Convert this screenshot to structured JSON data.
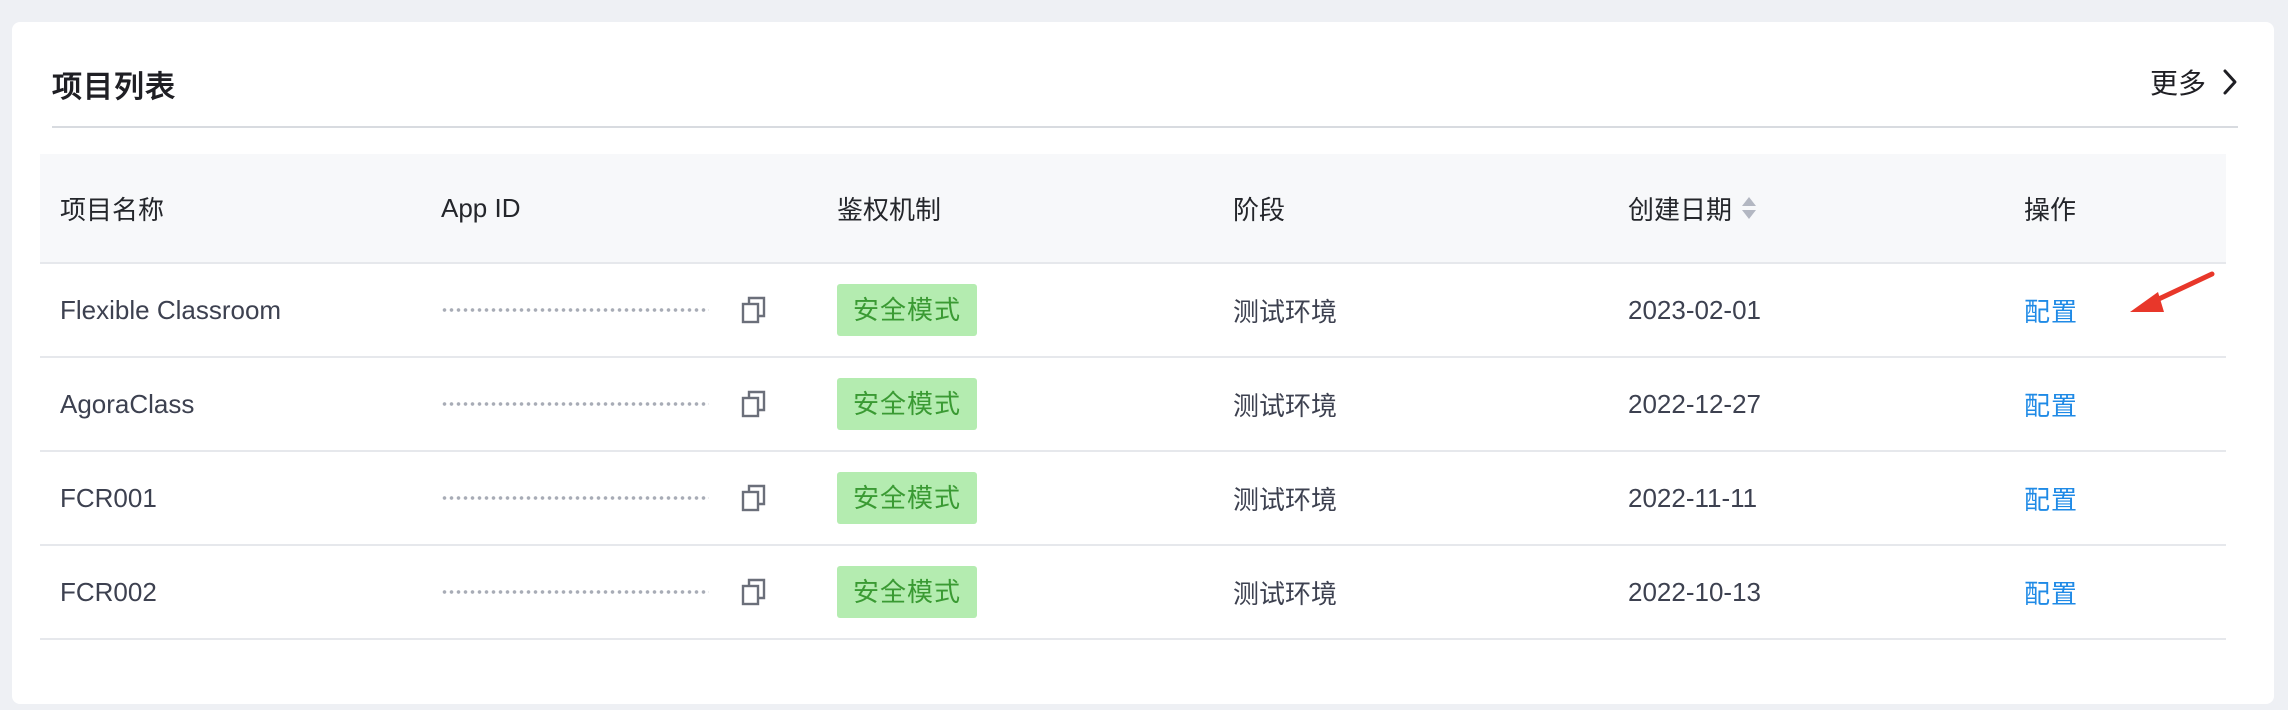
{
  "card": {
    "title": "项目列表",
    "more_label": "更多"
  },
  "table": {
    "headers": {
      "name": "项目名称",
      "app_id": "App ID",
      "auth": "鉴权机制",
      "stage": "阶段",
      "created": "创建日期",
      "ops": "操作"
    },
    "rows": [
      {
        "name": "Flexible Classroom",
        "auth": "安全模式",
        "stage": "测试环境",
        "created": "2023-02-01",
        "action": "配置"
      },
      {
        "name": "AgoraClass",
        "auth": "安全模式",
        "stage": "测试环境",
        "created": "2022-12-27",
        "action": "配置"
      },
      {
        "name": "FCR001",
        "auth": "安全模式",
        "stage": "测试环境",
        "created": "2022-11-11",
        "action": "配置"
      },
      {
        "name": "FCR002",
        "auth": "安全模式",
        "stage": "测试环境",
        "created": "2022-10-13",
        "action": "配置"
      }
    ]
  },
  "icons": {
    "more": "chevron-right-icon",
    "sort": "sort-icon",
    "copy": "copy-icon",
    "annotation": "red-arrow-annotation"
  },
  "colors": {
    "link": "#1f8ae6",
    "badge_bg": "#b4ecb0",
    "badge_text": "#3a9a33",
    "annotation": "#e8372a"
  }
}
